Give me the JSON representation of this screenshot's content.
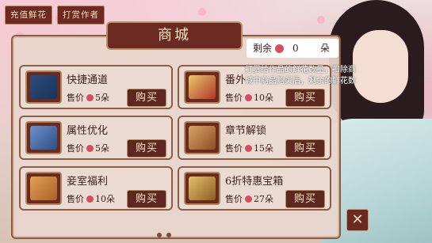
{
  "top_buttons": {
    "recharge": "充值鲜花",
    "reward_author": "打赏作者"
  },
  "shop": {
    "title": "商城",
    "items": [
      {
        "name": "快捷通道",
        "price_prefix": "售价",
        "price": "5朵",
        "buy": "购买"
      },
      {
        "name": "番外",
        "price_prefix": "售价",
        "price": "10朵",
        "buy": "购买"
      },
      {
        "name": "属性优化",
        "price_prefix": "售价",
        "price": "5朵",
        "buy": "购买"
      },
      {
        "name": "章节解锁",
        "price_prefix": "售价",
        "price": "15朵",
        "buy": "购买"
      },
      {
        "name": "妾室福利",
        "price_prefix": "售价",
        "price": "10朵",
        "buy": "购买"
      },
      {
        "name": "6折特惠宝箱",
        "price_prefix": "售价",
        "price": "27朵",
        "buy": "购买"
      }
    ]
  },
  "flowers_remaining": {
    "label": "剩余",
    "value": "0",
    "unit": "朵"
  },
  "tooltip": "打赏给作品的鲜花数量，扣除商城中商品购买后，剩余的鲜花数",
  "colors": {
    "button_bg": "#6a2a21",
    "gold_border": "#b88f63",
    "rose": "#d64d5f"
  },
  "icons": {
    "close": "close-icon",
    "rose": "rose-icon"
  }
}
